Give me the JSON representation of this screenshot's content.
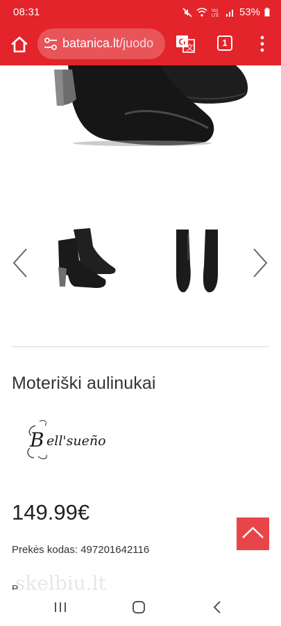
{
  "status_bar": {
    "time": "08:31",
    "battery": "53%",
    "icons": [
      "mute-icon",
      "wifi-icon",
      "volte-icon",
      "signal-icon",
      "battery-icon"
    ]
  },
  "browser": {
    "url_domain": "batanica.lt",
    "url_path": "/juodo",
    "tab_count": "1",
    "accent_color": "#e3242b"
  },
  "gallery": {
    "prev_icon": "chevron-left-icon",
    "next_icon": "chevron-right-icon"
  },
  "product": {
    "title": "Moteriški aulinukai",
    "brand_logo_text": "Bell'sueño",
    "price": "149.99€",
    "code_label": "Prekės kodas:",
    "code_value": "497201642116",
    "partial_next_line": "P..."
  },
  "watermark": "skelbiu.lt",
  "nav": {
    "icons": [
      "recent-apps-icon",
      "home-icon",
      "back-icon"
    ]
  }
}
